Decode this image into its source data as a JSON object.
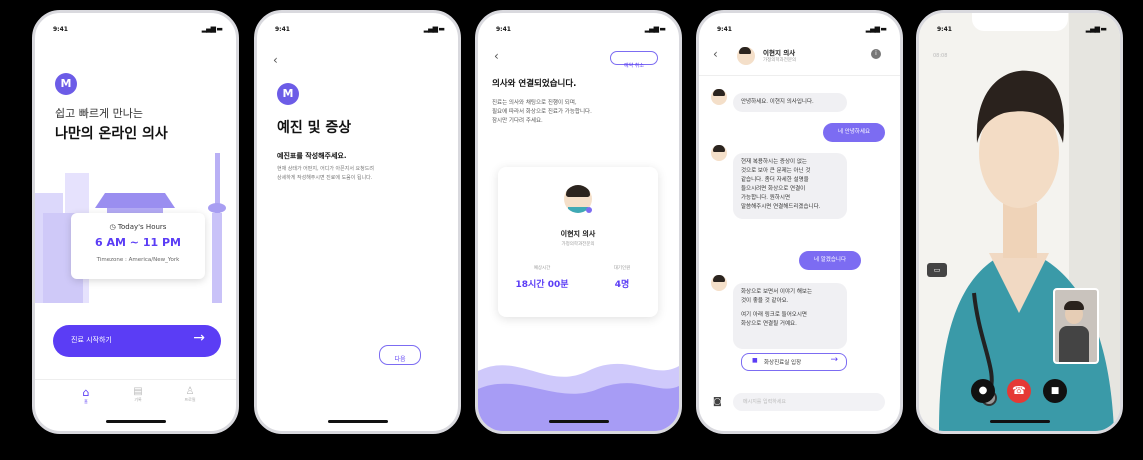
{
  "status_time": "9:41",
  "screen1": {
    "logo": "M",
    "headline_1": "쉽고 빠르게 만나는",
    "headline_2": "나만의 온라인 의사",
    "hours_label": "Today's Hours",
    "hours_value": "6 AM ~ 11 PM",
    "timezone": "Timezone : America/New_York",
    "start_button": "진료 시작하기",
    "nav": [
      "홈",
      "기록",
      "프로필"
    ]
  },
  "screen2": {
    "logo": "M",
    "title": "예진 및 증상",
    "subtitle": "예진표를 작성해주세요.",
    "desc_1": "현재 상태가 어떤지, 어디가 아픈지서 요청드려",
    "desc_2": "상세하게 작성해주시면 진료에 도움이 됩니다.",
    "next_button": "다음"
  },
  "screen3": {
    "cancel_button": "예약 취소",
    "title": "의사와 연결되었습니다.",
    "desc_1": "진료는 의사와 채팅으로 진행이 되며,",
    "desc_2": "필요에 따라서 화상으로 진료가 가능합니다.",
    "desc_3": "잠시만 기다려 주세요.",
    "doctor_name": "이현지 의사",
    "doctor_dept": "가정의학과전문의",
    "wait_time_label": "예상시간",
    "wait_time_value": "18시간 00분",
    "wait_count_label": "대기인원",
    "wait_count_value": "4명"
  },
  "screen4": {
    "doctor_name": "이현지 의사",
    "doctor_dept": "가정의학과전문의",
    "msg_1": "안녕하세요. 이현지 의사입니다.",
    "msg_2": "네 안녕하세요",
    "msg_3_lines": [
      "현재 복용하시는 증상이 없는",
      "것으로 보아 큰 문제는 아닌 것",
      "같습니다. 좀더 자세한 설명을",
      "들으시려면 화상으로 연결이",
      "가능합니다. 원하시면",
      "말씀해주시면 연결해드리겠습니다."
    ],
    "msg_4": "네 알겠습니다",
    "msg_5_lines": [
      "화상으로 보면서 이야기 해보는",
      "것이 좋을 것 같아요.",
      "",
      "여기 아래 링크로 들어오시면",
      "화상으로 연결될 거예요."
    ],
    "video_button": "화상진료실 입장",
    "input_placeholder": "메시지를 입력하세요"
  },
  "screen5": {
    "status_left": "08:08"
  }
}
